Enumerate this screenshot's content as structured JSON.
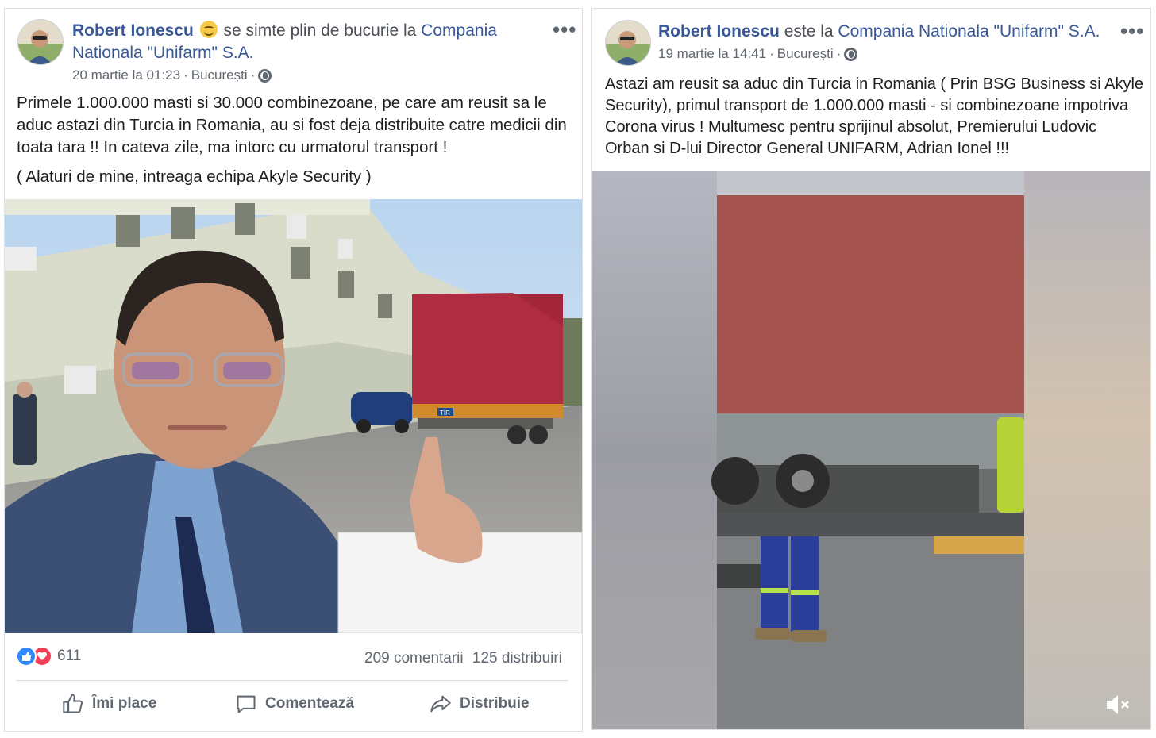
{
  "post1": {
    "author": "Robert Ionescu",
    "feeling": "se simte plin de bucurie la",
    "place_line1": "Compania",
    "place_line2": "Nationala \"Unifarm\" S.A.",
    "date": "20 martie la 01:23",
    "location": "București",
    "text_lines": [
      "Primele 1.000.000 masti si 30.000 combinezoane, pe care am reusit sa le",
      "aduc astazi din Turcia in Romania, au si fost deja distribuite catre medicii din",
      "toata tara !! In cateva zile, ma intorc cu urmatorul transport !"
    ],
    "text_extra": "( Alaturi de mine, intreaga echipa Akyle Security )",
    "reaction_count": "611",
    "comments": "209 comentarii",
    "shares": "125 distribuiri",
    "actions": {
      "like": "Îmi place",
      "comment": "Comentează",
      "share": "Distribuie"
    },
    "truck_label": "TIR"
  },
  "post2": {
    "author": "Robert Ionescu",
    "connector": "este la",
    "place": "Compania Nationala \"Unifarm\" S.A.",
    "date": "19 martie la 14:41",
    "location": "București",
    "text_lines": [
      "Astazi am reusit sa aduc din Turcia in Romania ( Prin BSG Business si Akyle",
      "Security), primul transport de 1.000.000 masti - si combinezoane impotriva",
      "Corona virus ! Multumesc pentru sprijinul absolut, Premierului Ludovic",
      "Orban si D-lui Director General UNIFARM, Adrian Ionel !!!"
    ]
  },
  "icons": [
    "globe-icon",
    "more-options-icon",
    "like-reaction-icon",
    "love-reaction-icon",
    "thumbs-up-icon",
    "comment-icon",
    "share-icon",
    "mute-icon"
  ],
  "colors": {
    "link": "#385898",
    "like": "#2d88ff",
    "love": "#f33e58",
    "muted": "#606770"
  }
}
